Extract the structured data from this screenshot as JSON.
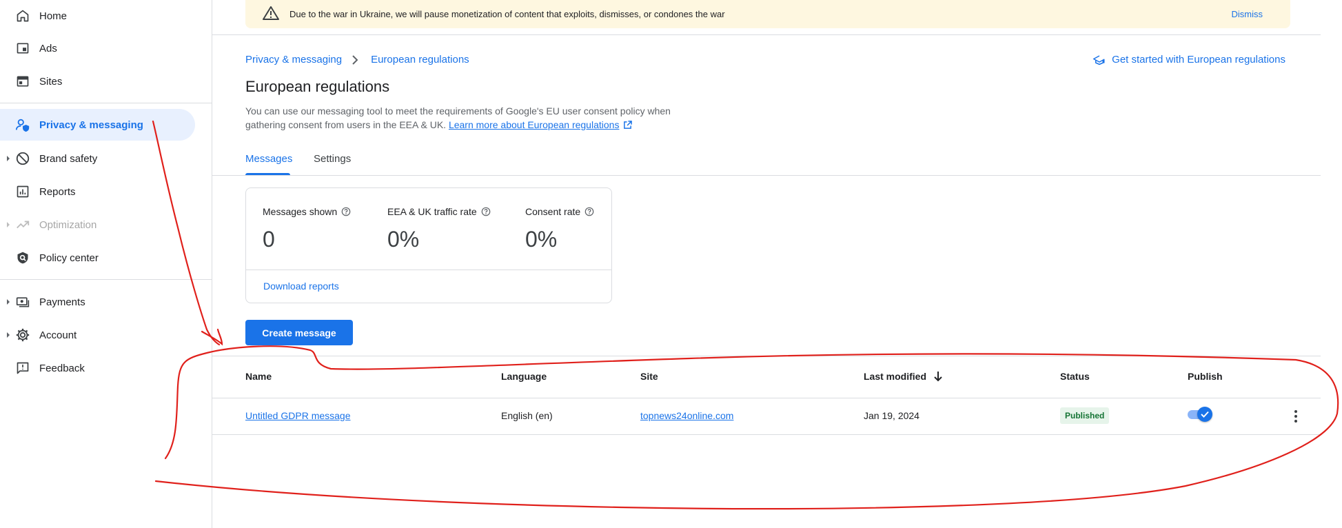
{
  "sidebar": {
    "items": [
      {
        "label": "Home",
        "icon": "home-icon"
      },
      {
        "label": "Ads",
        "icon": "ads-icon"
      },
      {
        "label": "Sites",
        "icon": "sites-icon"
      },
      {
        "label": "Privacy & messaging",
        "icon": "privacy-icon",
        "active": true
      },
      {
        "label": "Brand safety",
        "icon": "block-icon",
        "expandable": true
      },
      {
        "label": "Reports",
        "icon": "reports-icon"
      },
      {
        "label": "Optimization",
        "icon": "optimization-icon",
        "expandable": true,
        "disabled": true
      },
      {
        "label": "Policy center",
        "icon": "policy-shield-icon"
      },
      {
        "label": "Payments",
        "icon": "payments-icon",
        "expandable": true
      },
      {
        "label": "Account",
        "icon": "gear-icon",
        "expandable": true
      },
      {
        "label": "Feedback",
        "icon": "feedback-icon"
      }
    ]
  },
  "banner": {
    "message": "Due to the war in Ukraine, we will pause monetization of content that exploits, dismisses, or condones the war",
    "dismiss_label": "Dismiss",
    "icon": "warning-icon"
  },
  "breadcrumb": {
    "parent": "Privacy & messaging",
    "current": "European regulations"
  },
  "get_started_link": "Get started with European regulations",
  "page": {
    "title": "European regulations",
    "description": "You can use our messaging tool to meet the requirements of Google's EU user consent policy when gathering consent from users in the EEA & UK.",
    "learn_more": "Learn more about European regulations"
  },
  "tabs": [
    {
      "label": "Messages",
      "active": true
    },
    {
      "label": "Settings",
      "active": false
    }
  ],
  "stats": [
    {
      "label": "Messages shown",
      "value": "0"
    },
    {
      "label": "EEA & UK traffic rate",
      "value": "0%"
    },
    {
      "label": "Consent rate",
      "value": "0%"
    }
  ],
  "download_reports": "Download reports",
  "create_message": "Create message",
  "table": {
    "headers": [
      "Name",
      "Language",
      "Site",
      "Last modified",
      "Status",
      "Publish"
    ],
    "rows": [
      {
        "name": "Untitled GDPR message",
        "language": "English (en)",
        "site": "topnews24online.com",
        "last_modified": "Jan 19, 2024",
        "status": "Published",
        "publish": true
      }
    ]
  },
  "colors": {
    "accent": "#1a73e8",
    "banner_bg": "#fef7e0",
    "status_green": "#137333",
    "annotation_red": "#e0201b"
  }
}
